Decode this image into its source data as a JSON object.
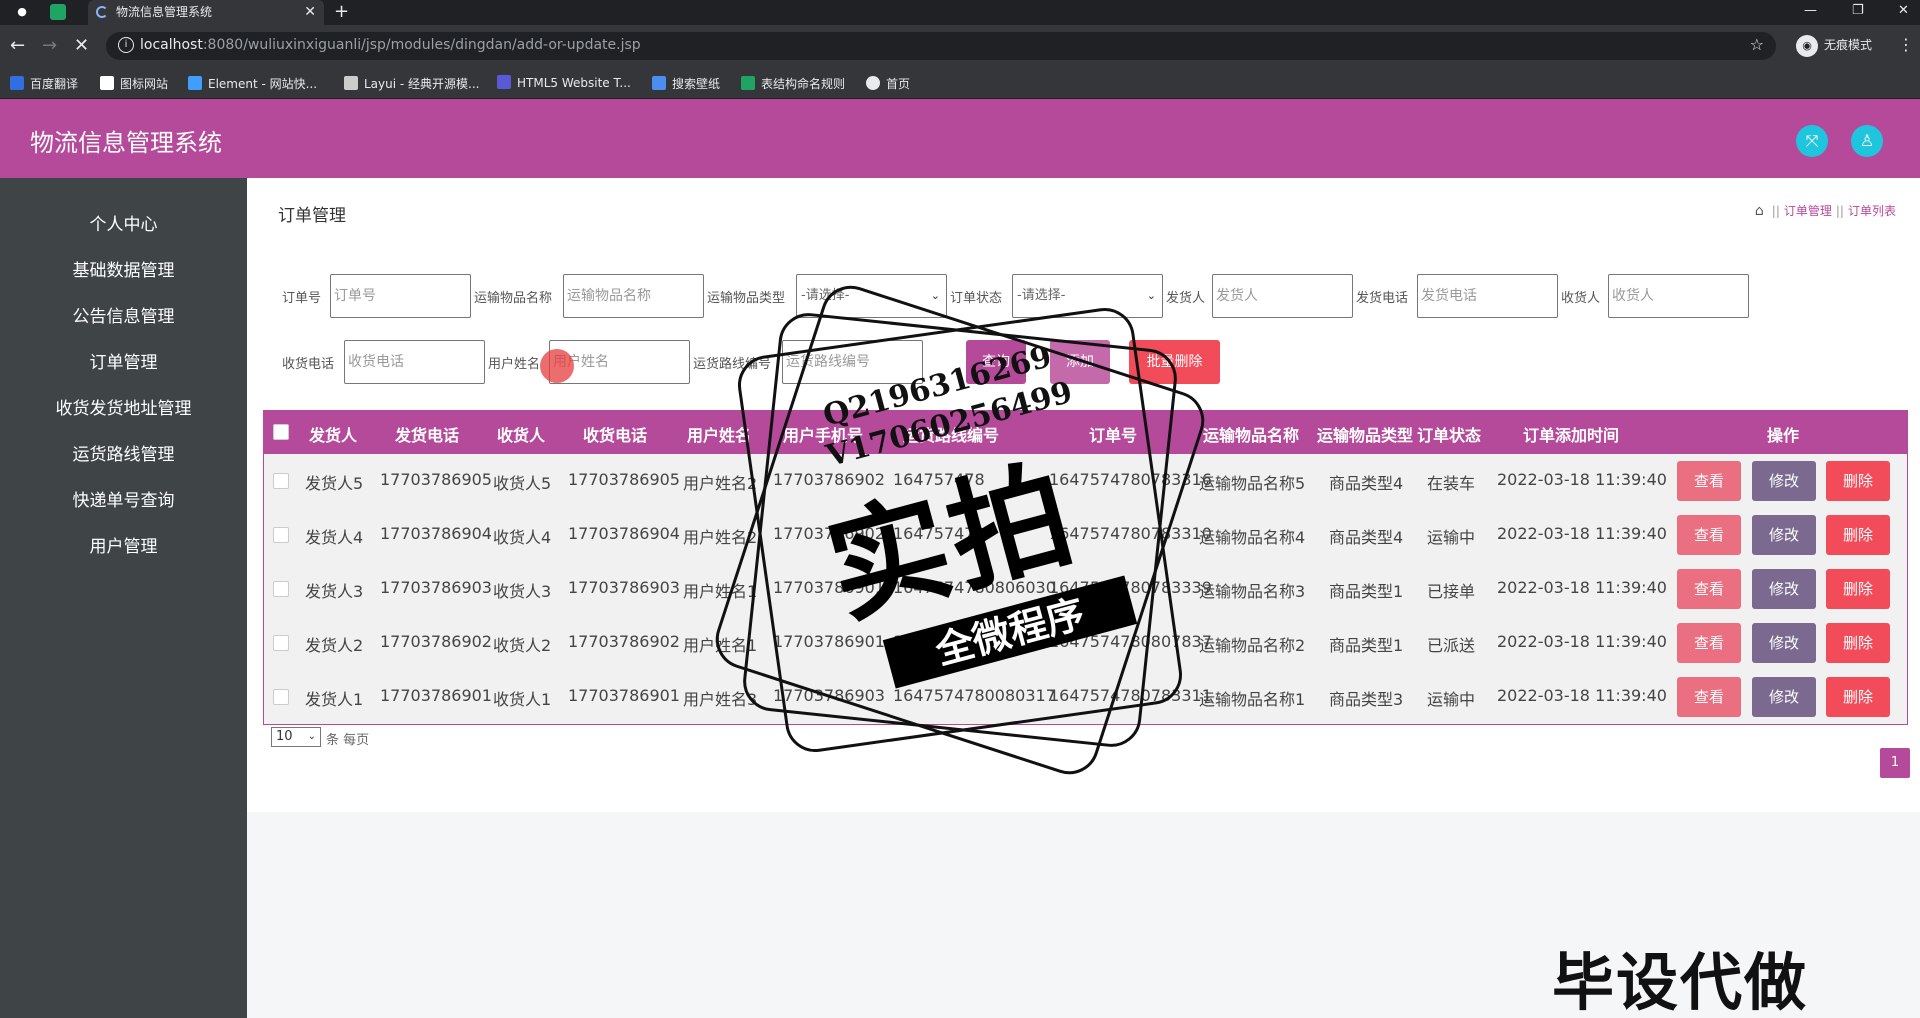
{
  "browser": {
    "tab_title": "物流信息管理系统",
    "url_host": "localhost",
    "url_rest": ":8080/wuliuxinxiguanli/jsp/modules/dingdan/add-or-update.jsp",
    "incognito_label": "无痕模式",
    "bookmarks": [
      {
        "label": "百度翻译",
        "color": "#2f6fe0"
      },
      {
        "label": "图标网站",
        "color": "#ffffff"
      },
      {
        "label": "Element - 网站快...",
        "color": "#409eff"
      },
      {
        "label": "Layui - 经典开源模...",
        "color": "#cccccc"
      },
      {
        "label": "HTML5 Website T...",
        "color": "#5a5ad6"
      },
      {
        "label": "搜索壁纸",
        "color": "#4a8ef0"
      },
      {
        "label": "表结构命名规则",
        "color": "#1fa463"
      },
      {
        "label": "首页",
        "color": "#e8eaed"
      }
    ]
  },
  "app": {
    "title": "物流信息管理系统",
    "header_color": "#b54a9b",
    "icon_color": "#1ec5dc"
  },
  "sidebar": {
    "items": [
      "个人中心",
      "基础数据管理",
      "公告信息管理",
      "订单管理",
      "收货发货地址管理",
      "运货路线管理",
      "快递单号查询",
      "用户管理"
    ]
  },
  "page": {
    "title": "订单管理",
    "breadcrumb": [
      "订单管理",
      "订单列表"
    ]
  },
  "search": {
    "order_no": {
      "label": "订单号",
      "placeholder": "订单号"
    },
    "item_name": {
      "label": "运输物品名称",
      "placeholder": "运输物品名称"
    },
    "item_type": {
      "label": "运输物品类型",
      "value": "-请选择-"
    },
    "order_status": {
      "label": "订单状态",
      "value": "-请选择-"
    },
    "sender": {
      "label": "发货人",
      "placeholder": "发货人"
    },
    "sender_phone": {
      "label": "发货电话",
      "placeholder": "发货电话"
    },
    "receiver": {
      "label": "收货人",
      "placeholder": "收货人"
    },
    "receiver_phone": {
      "label": "收货电话",
      "placeholder": "收货电话"
    },
    "user_name": {
      "label": "用户姓名",
      "placeholder": "用户姓名"
    },
    "route_no": {
      "label": "运货路线编号",
      "placeholder": "运货路线编号"
    },
    "query_label": "查询",
    "add_label": "添加",
    "batch_delete_label": "批量删除"
  },
  "table": {
    "headers": [
      "发货人",
      "发货电话",
      "收货人",
      "收货电话",
      "用户姓名",
      "用户手机号",
      "运货路线编号",
      "订单号",
      "运输物品名称",
      "运输物品类型",
      "订单状态",
      "订单添加时间",
      "操作"
    ],
    "rows": [
      [
        "发货人5",
        "17703786905",
        "收货人5",
        "17703786905",
        "用户姓名2",
        "17703786902",
        "164757478",
        "1647574780783316",
        "运输物品名称5",
        "商品类型4",
        "在装车",
        "2022-03-18 11:39:40"
      ],
      [
        "发货人4",
        "17703786904",
        "收货人4",
        "17703786904",
        "用户姓名2",
        "17703786902",
        "164757478",
        "1647574780783310",
        "运输物品名称4",
        "商品类型4",
        "运输中",
        "2022-03-18 11:39:40"
      ],
      [
        "发货人3",
        "17703786903",
        "收货人3",
        "17703786903",
        "用户姓名1",
        "17703786901",
        "1647574780806030",
        "1647574780783339",
        "运输物品名称3",
        "商品类型1",
        "已接单",
        "2022-03-18 11:39:40"
      ],
      [
        "发货人2",
        "17703786902",
        "收货人2",
        "17703786902",
        "用户姓名1",
        "17703786901",
        "1647574780806030",
        "1647574780807837",
        "运输物品名称2",
        "商品类型1",
        "已派送",
        "2022-03-18 11:39:40"
      ],
      [
        "发货人1",
        "17703786901",
        "收货人1",
        "17703786901",
        "用户姓名3",
        "17703786903",
        "1647574780080317",
        "1647574780783311",
        "运输物品名称1",
        "商品类型3",
        "运输中",
        "2022-03-18 11:39:40"
      ]
    ],
    "view_label": "查看",
    "edit_label": "修改",
    "delete_label": "删除"
  },
  "pagination": {
    "page_size": "10",
    "page_size_label": "条 每页",
    "current_page": "1"
  },
  "watermark": {
    "qq": "Q2196316269",
    "vx": "V17060256499",
    "big": "实拍",
    "ribbon": "全微程序",
    "corner": "毕设代做"
  }
}
